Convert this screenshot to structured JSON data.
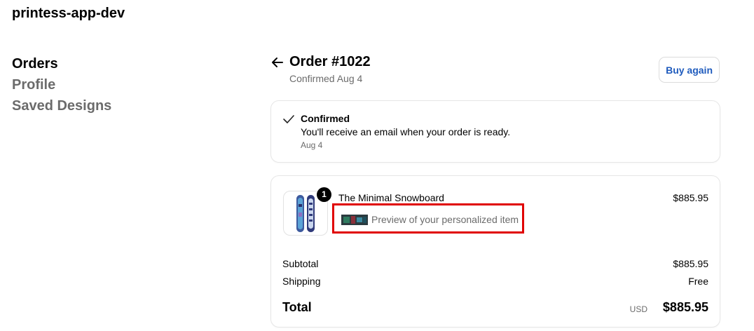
{
  "header": {
    "shop_name": "printess-app-dev"
  },
  "sidebar": {
    "items": [
      {
        "label": "Orders",
        "active": true
      },
      {
        "label": "Profile",
        "active": false
      },
      {
        "label": "Saved Designs",
        "active": false
      }
    ]
  },
  "order": {
    "title": "Order #1022",
    "subtitle": "Confirmed Aug 4",
    "buy_again_label": "Buy again",
    "back_icon": "arrow-left-icon"
  },
  "status": {
    "icon": "check-icon",
    "title": "Confirmed",
    "message": "You'll receive an email when your order is ready.",
    "date": "Aug 4"
  },
  "line_item": {
    "quantity": "1",
    "name": "The Minimal Snowboard",
    "price": "$885.95",
    "preview_label": "Preview of your personalized item"
  },
  "summary": {
    "subtotal_label": "Subtotal",
    "subtotal_value": "$885.95",
    "shipping_label": "Shipping",
    "shipping_value": "Free",
    "total_label": "Total",
    "currency": "USD",
    "total_value": "$885.95"
  },
  "colors": {
    "accent_link": "#1f5bbd",
    "highlight_border": "#e00000",
    "muted_text": "#6b6b6b"
  }
}
